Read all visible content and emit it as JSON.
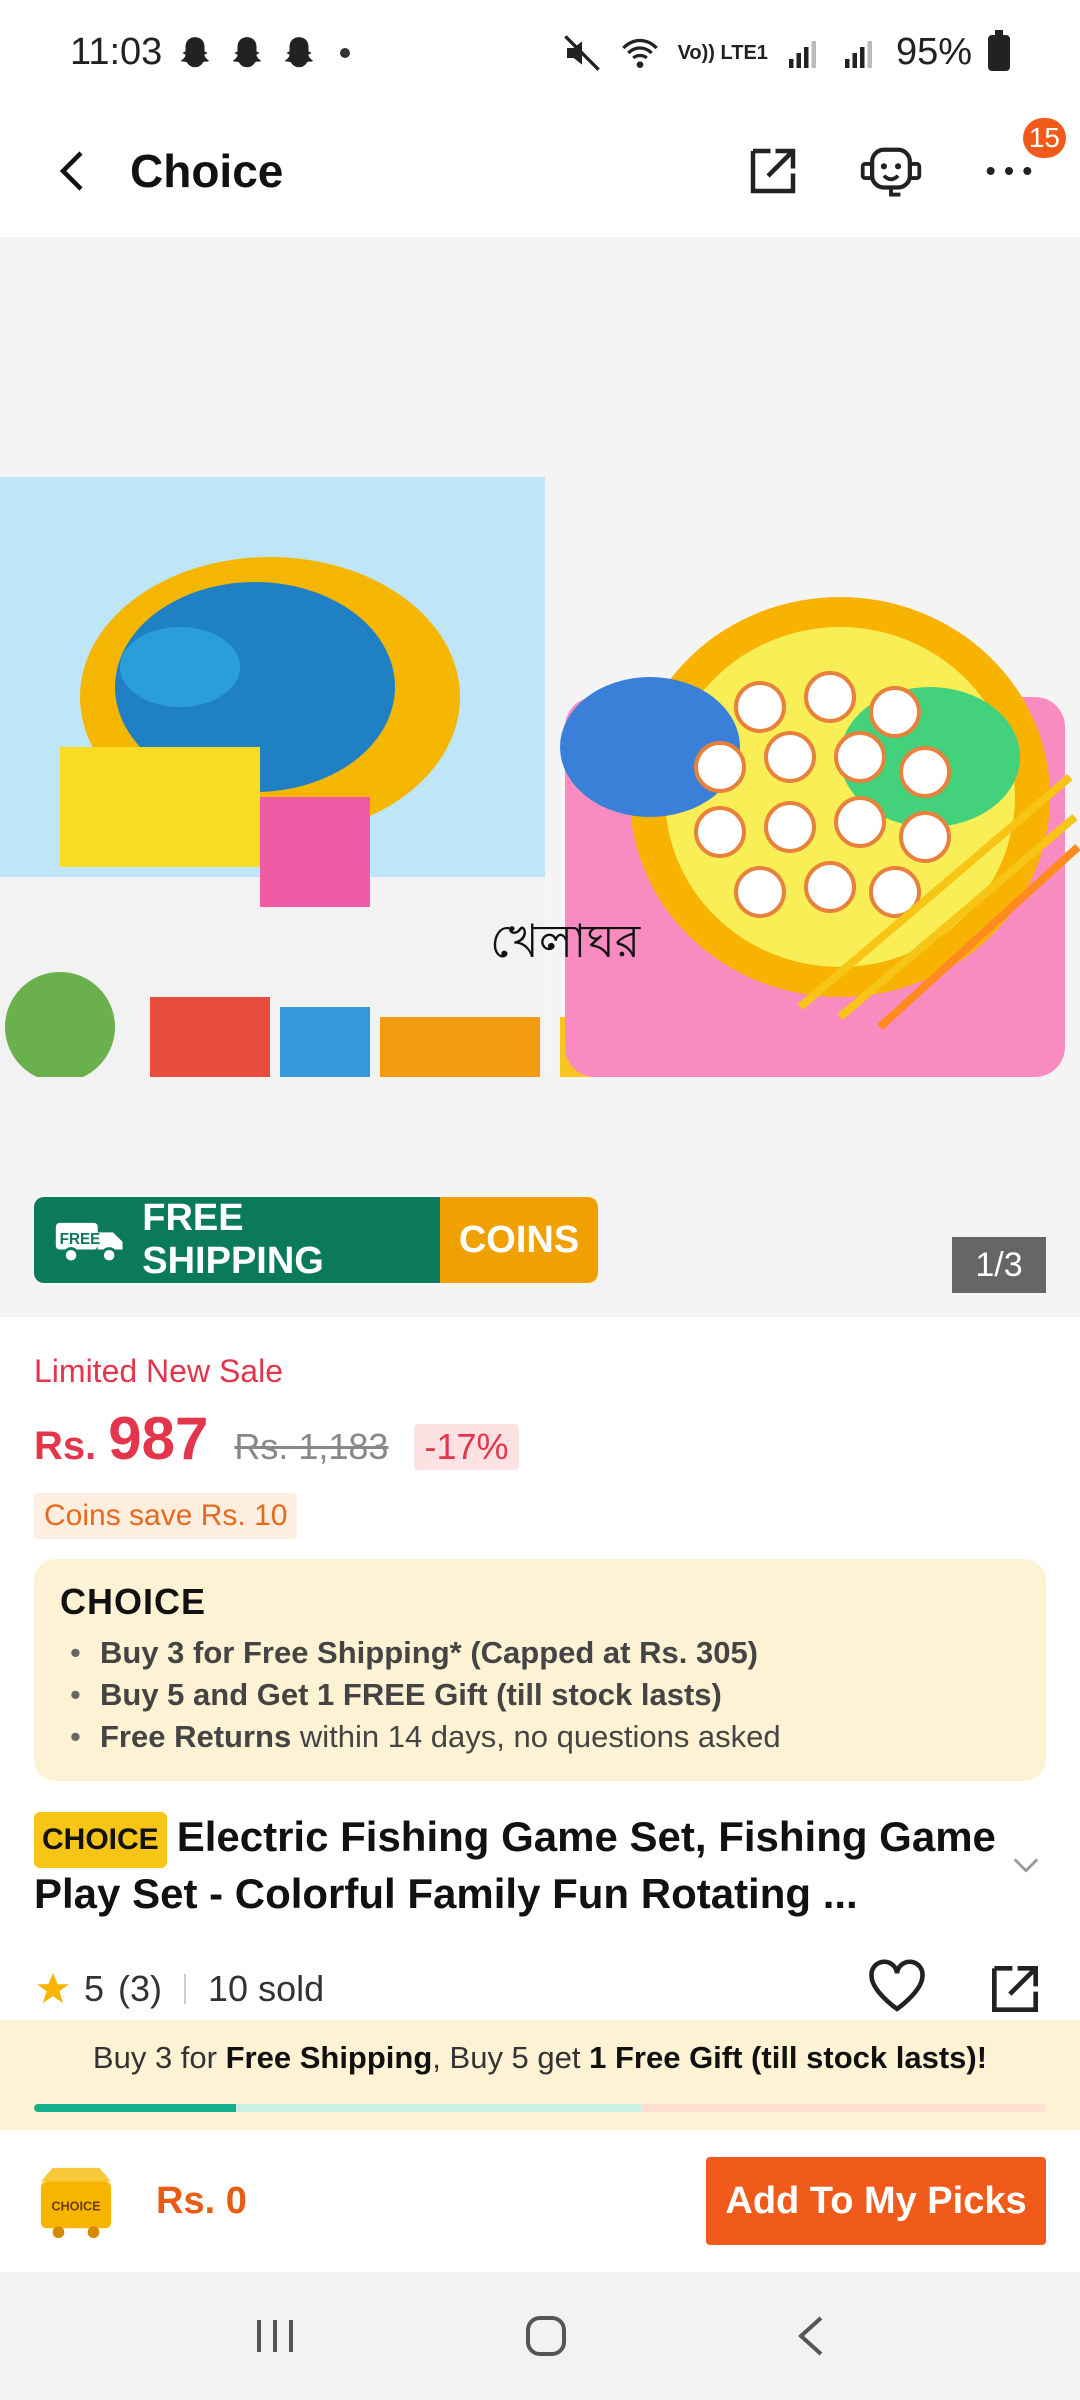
{
  "status_bar": {
    "time": "11:03",
    "battery": "95%",
    "network": "Vo)) LTE1"
  },
  "app_bar": {
    "title": "Choice",
    "badge_count": "15"
  },
  "gallery": {
    "bengali_text": "খেলাঘর",
    "page_indicator": "1/3",
    "promo_free_tag": "FREE",
    "promo_free_label": "FREE SHIPPING",
    "promo_coins_label": "COINS"
  },
  "pricing": {
    "sale_label": "Limited New Sale",
    "currency": "Rs.",
    "price": "987",
    "original_price": "Rs. 1,183",
    "discount": "-17%",
    "coins_save": "Coins save Rs. 10"
  },
  "choice_card": {
    "logo": "CHOICE",
    "line1": "Buy 3 for  Free Shipping* (Capped at Rs. 305)",
    "line2": "Buy 5 and Get 1 FREE Gift (till stock lasts)",
    "line3_bold": "Free Returns",
    "line3_rest": " within 14 days, no questions asked"
  },
  "product": {
    "choice_tag": "CHOICE",
    "title": "Electric Fishing Game Set, Fishing Game Play Set - Colorful Family Fun Rotating ..."
  },
  "rating": {
    "value": "5",
    "count": "(3)",
    "sold": "10 sold",
    "stars_filled": 1
  },
  "promo_strip": {
    "p1": "Buy 3 for ",
    "p2": "Free Shipping",
    "p3": ", Buy 5 get ",
    "p4": "1 Free Gift (till stock lasts)!",
    "progress_percent": 20
  },
  "action_bar": {
    "cart_label": "CHOICE",
    "total": "Rs. 0",
    "add_button": "Add To My Picks"
  },
  "colors": {
    "accent": "#f05a1a",
    "sale_red": "#e3354b",
    "choice_yellow": "#f7c516",
    "promo_green": "#0b7a5b"
  }
}
